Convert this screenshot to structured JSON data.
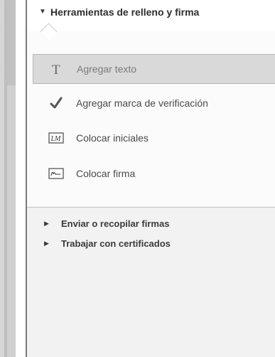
{
  "panel": {
    "section_title": "Herramientas de relleno y firma",
    "tools": [
      {
        "label": "Agregar texto",
        "icon": "text-icon",
        "selected": true
      },
      {
        "label": "Agregar marca de verificación",
        "icon": "checkmark-icon",
        "selected": false
      },
      {
        "label": "Colocar iniciales",
        "icon": "initials-icon",
        "selected": false
      },
      {
        "label": "Colocar firma",
        "icon": "signature-icon",
        "selected": false
      }
    ],
    "subsections": [
      {
        "label": "Enviar o recopilar firmas"
      },
      {
        "label": "Trabajar con certificados"
      }
    ]
  },
  "colors": {
    "panel_bg": "#f2f2f2",
    "selected_bg": "#d9d9d9",
    "text": "#4a4a4a"
  }
}
